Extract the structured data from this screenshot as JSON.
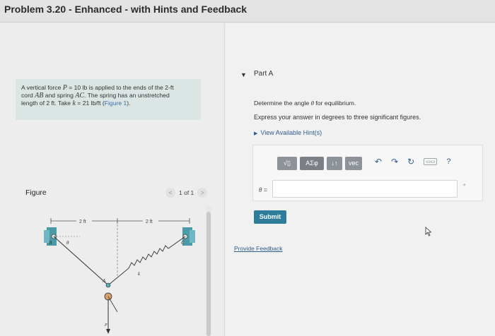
{
  "window": {
    "title": "Problem 3.20 - Enhanced - with Hints and Feedback"
  },
  "problem": {
    "line1": "A vertical force ",
    "var_p": "P",
    "line1b": " = 10 lb is applied to the ends of the 2-ft",
    "line2a": "cord ",
    "var_ab": "AB",
    "line2b": " and spring ",
    "var_ac": "AC",
    "line2c": ". The spring has an unstretched",
    "line3a": "length of 2 ft. Take ",
    "var_k": "k",
    "line3b": " = 21 lb/ft (",
    "figure_link": "Figure 1",
    "line3c": ")."
  },
  "figure_panel": {
    "label": "Figure",
    "pager": "1 of 1",
    "prev_glyph": "<",
    "next_glyph": ">"
  },
  "figure": {
    "dim_left": "2 ft",
    "dim_right": "2 ft",
    "pt_b": "B",
    "pt_c": "C",
    "pt_a": "A",
    "theta": "θ",
    "spring_k": "k",
    "force_p": "P"
  },
  "part": {
    "toggle": "▼",
    "label": "Part A"
  },
  "question": {
    "text_a": "Determine the angle ",
    "var": "θ",
    "text_b": " for equilibrium."
  },
  "instruction": "Express your answer in degrees to three significant figures.",
  "hints": {
    "label": "View Available Hint(s)",
    "arrow": "▶"
  },
  "toolbar": {
    "templates": "√▯",
    "symbols": "ΑΣφ",
    "updown": "↓↑",
    "vec": "vec",
    "undo": "↶",
    "redo": "↷",
    "reset": "↻",
    "keyboard": "▭▭",
    "help": "?"
  },
  "answer": {
    "label_var": "θ",
    "label_eq": " =",
    "value": "",
    "unit": "°"
  },
  "submit_label": "Submit",
  "feedback_label": "Provide Feedback"
}
